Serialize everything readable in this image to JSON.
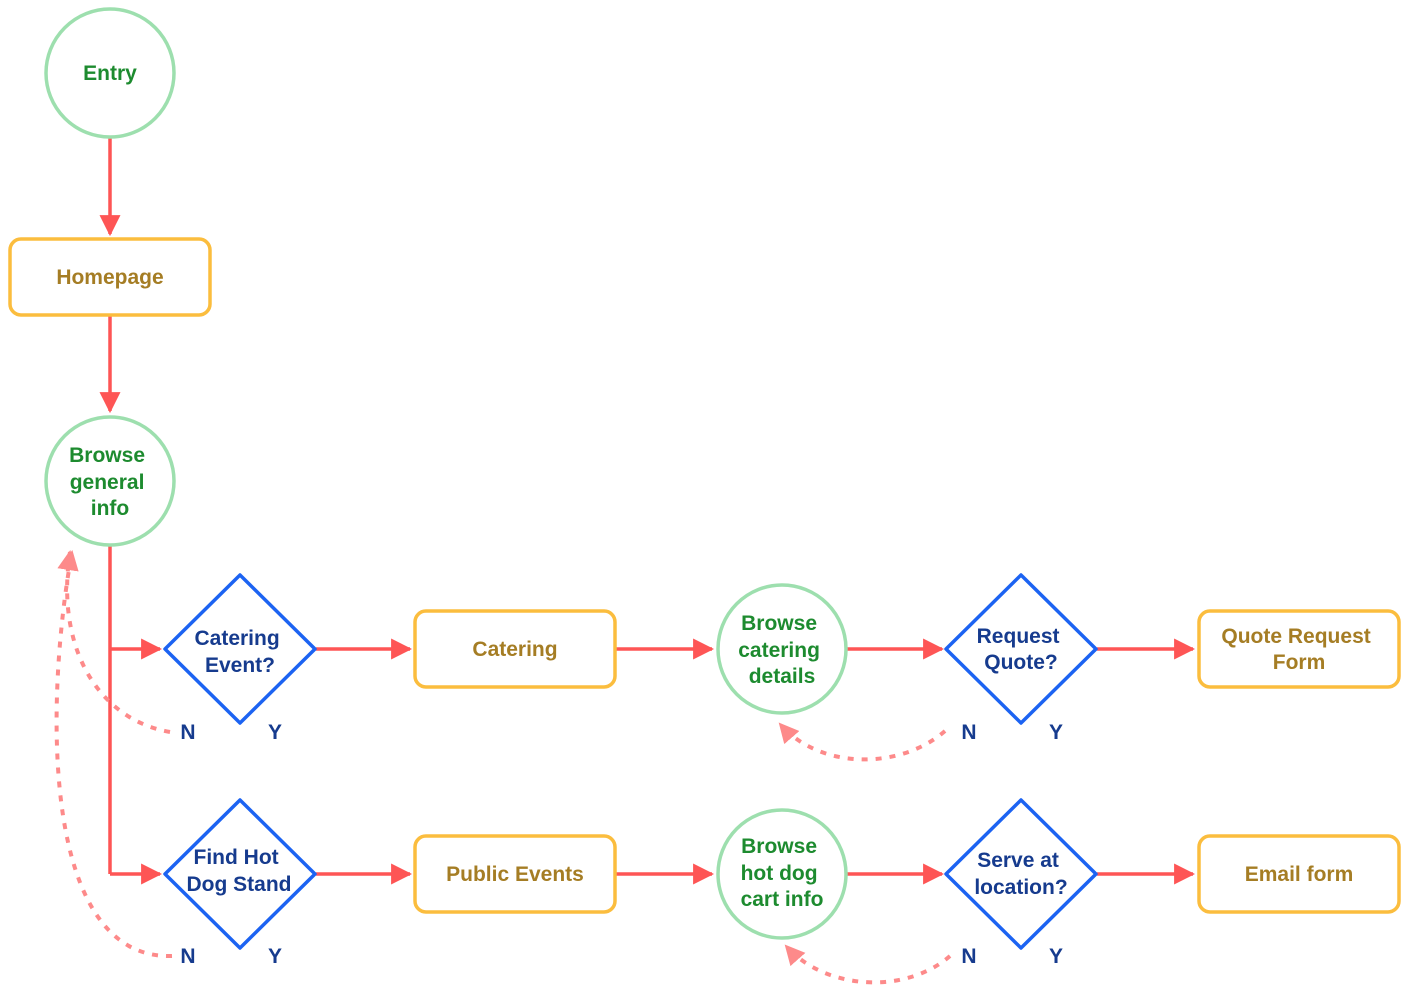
{
  "colors": {
    "flow_arrow": "#fe5555",
    "return_arrow": "#fd8a8a",
    "page_node": "#fbbd3e",
    "action_node": "#9ddfae",
    "decision_node": "#1c63f2"
  },
  "nodes": {
    "entry": [
      "Entry"
    ],
    "homepage": [
      "Homepage"
    ],
    "browse_general": [
      "Browse",
      "general",
      "info"
    ],
    "catering_event": [
      "Catering",
      "Event?"
    ],
    "catering": [
      "Catering"
    ],
    "browse_catering": [
      "Browse",
      "catering",
      "details"
    ],
    "request_quote": [
      "Request",
      "Quote?"
    ],
    "quote_form": [
      "Quote Request",
      "Form"
    ],
    "find_stand": [
      "Find Hot",
      "Dog Stand"
    ],
    "public_events": [
      "Public Events"
    ],
    "browse_cart": [
      "Browse",
      "hot dog",
      "cart info"
    ],
    "serve_location": [
      "Serve at",
      "location?"
    ],
    "email_form": [
      "Email form"
    ]
  },
  "labels": {
    "no": "N",
    "yes": "Y"
  }
}
